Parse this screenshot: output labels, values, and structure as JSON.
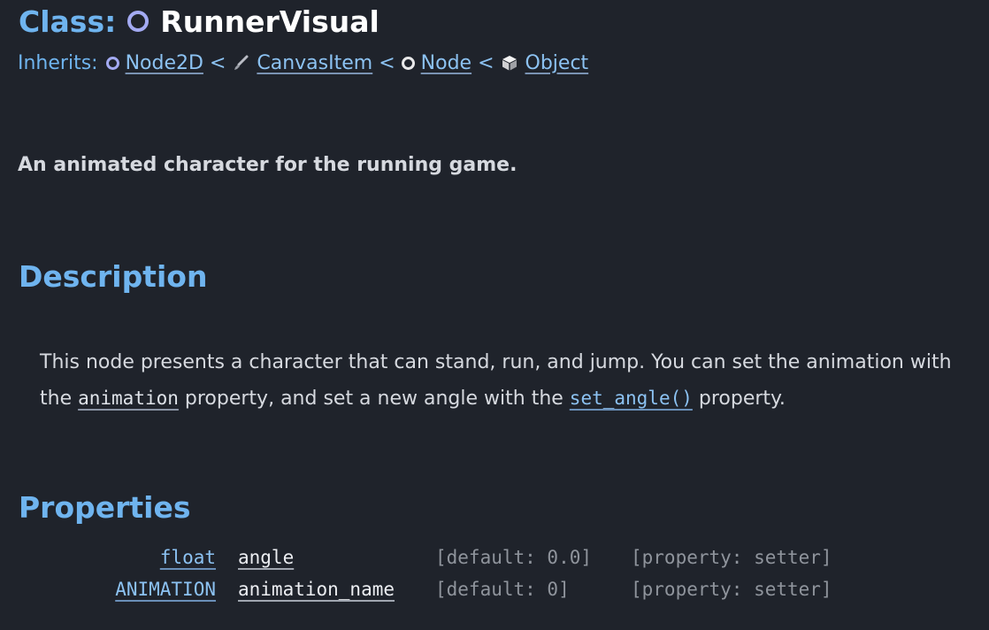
{
  "header": {
    "class_label": "Class:",
    "class_name": "RunnerVisual",
    "class_icon": "node2d-ring-icon",
    "inherits_label": "Inherits:",
    "inherits": [
      {
        "name": "Node2D",
        "icon": "node2d-ring-icon"
      },
      {
        "name": "CanvasItem",
        "icon": "brush-icon"
      },
      {
        "name": "Node",
        "icon": "node-ring-icon"
      },
      {
        "name": "Object",
        "icon": "cube-icon"
      }
    ],
    "separator": "<"
  },
  "brief": "An animated character for the running game.",
  "description": {
    "heading": "Description",
    "text_1": "This node presents a character that can stand, run, and jump. You can set the animation with the ",
    "link_1": "animation",
    "text_2": " property, and set a new angle with the ",
    "link_2": "set_angle()",
    "text_3": " property."
  },
  "properties": {
    "heading": "Properties",
    "rows": [
      {
        "type": "float",
        "name": "angle",
        "default": "[default: 0.0]",
        "setter": "[property: setter]"
      },
      {
        "type": "ANIMATION",
        "name": "animation_name",
        "default": "[default: 0]",
        "setter": "[property: setter]"
      }
    ]
  },
  "colors": {
    "background": "#1f232b",
    "heading": "#6fb4ef",
    "link": "#8cc2f2",
    "text": "#d6d9df",
    "muted": "#8f949c",
    "node2d_icon": "#a3aaf2"
  }
}
